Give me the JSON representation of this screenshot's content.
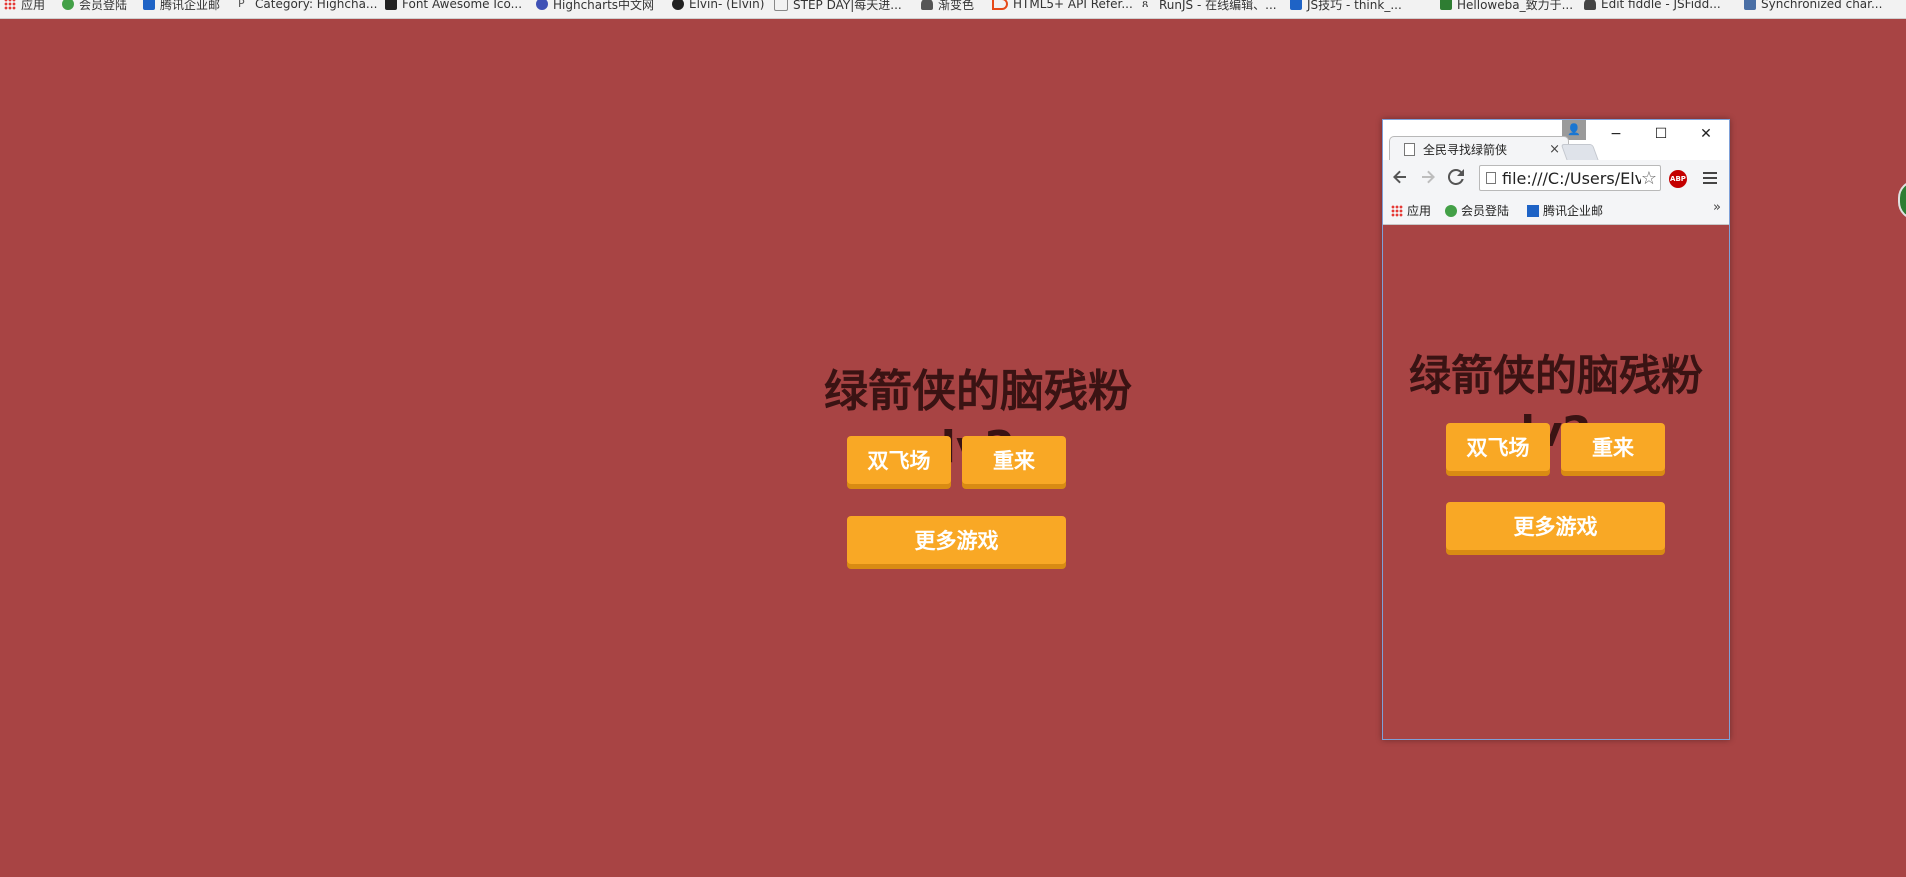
{
  "bookmarks_bar": {
    "items": [
      {
        "label": "应用",
        "icon": "apps-icon",
        "color": "#e53935"
      },
      {
        "label": "会员登陆",
        "icon": "recycle-icon",
        "color": "#43a047"
      },
      {
        "label": "腾讯企业邮",
        "icon": "mail-icon",
        "color": "#1e63c6"
      },
      {
        "label": "Category: Highcha...",
        "icon": "p-icon",
        "color": "#555555"
      },
      {
        "label": "Font Awesome Ico...",
        "icon": "flag-icon",
        "color": "#222222"
      },
      {
        "label": "Highcharts中文网",
        "icon": "globe-icon",
        "color": "#3f51b5"
      },
      {
        "label": "Elvin- (Elvin)",
        "icon": "github-icon",
        "color": "#222222"
      },
      {
        "label": "STEP DAY|每天进...",
        "icon": "doc-icon",
        "color": "#888888"
      },
      {
        "label": "渐变色",
        "icon": "cloud-icon",
        "color": "#555555"
      },
      {
        "label": "HTML5+ API Refer...",
        "icon": "d-icon",
        "color": "#e64a19"
      },
      {
        "label": "RunJS - 在线编辑、...",
        "icon": "run-icon",
        "color": "#333333"
      },
      {
        "label": "JS技巧 - think_...",
        "icon": "blog-icon",
        "color": "#1e63c6"
      },
      {
        "label": "Helloweba_致力于...",
        "icon": "h-icon",
        "color": "#2e7d32"
      },
      {
        "label": "Edit fiddle - JSFidd...",
        "icon": "cloud-icon",
        "color": "#444444"
      },
      {
        "label": "Synchronized char...",
        "icon": "chart-icon",
        "color": "#4a6fa5"
      }
    ]
  },
  "main_page": {
    "title": "绿箭侠的脑残粉lv2",
    "buttons": {
      "double_fly": "双飞场",
      "replay": "重来",
      "more_games": "更多游戏"
    }
  },
  "small_window": {
    "tab_title": "全民寻找绿箭侠",
    "tab_close": "×",
    "controls": {
      "minimize": "−",
      "maximize": "☐",
      "close": "✕"
    },
    "url": "file:///C:/Users/Elvin/",
    "abp_label": "ABP",
    "bookmarks": [
      {
        "label": "应用",
        "icon": "apps-icon"
      },
      {
        "label": "会员登陆",
        "icon": "recycle-icon"
      },
      {
        "label": "腾讯企业邮",
        "icon": "mail-icon"
      }
    ],
    "overflow_chevron": "»",
    "page": {
      "title": "绿箭侠的脑残粉lv2",
      "buttons": {
        "double_fly": "双飞场",
        "replay": "重来",
        "more_games": "更多游戏"
      }
    }
  },
  "colors": {
    "page_background": "#a84444",
    "button": "#f9a825",
    "button_shadow": "#d98b13",
    "title_text": "#3a1313"
  }
}
